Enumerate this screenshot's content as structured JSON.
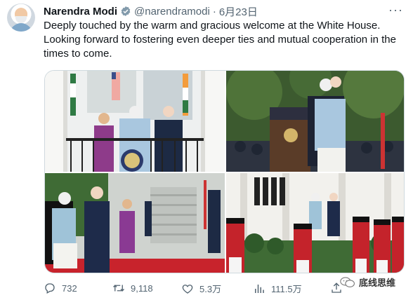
{
  "author": {
    "name": "Narendra Modi",
    "handle": "@narendramodi",
    "separator": "·",
    "date": "6月23日"
  },
  "tweet": {
    "text": "Deeply touched by the warm and gracious welcome at the White House. Looking forward to fostering even deeper ties and mutual cooperation in the times to come."
  },
  "actions": {
    "replies": "732",
    "retweets": "9,118",
    "likes": "5.3万",
    "views": "111.5万"
  },
  "watermark": {
    "text": "底线思维"
  },
  "colors": {
    "text": "#0f1419",
    "secondary": "#536471",
    "verified": "#829aab"
  },
  "icons": [
    "verified-badge-icon",
    "more-icon",
    "reply-icon",
    "retweet-icon",
    "like-icon",
    "views-icon",
    "share-icon",
    "wechat-icon"
  ]
}
